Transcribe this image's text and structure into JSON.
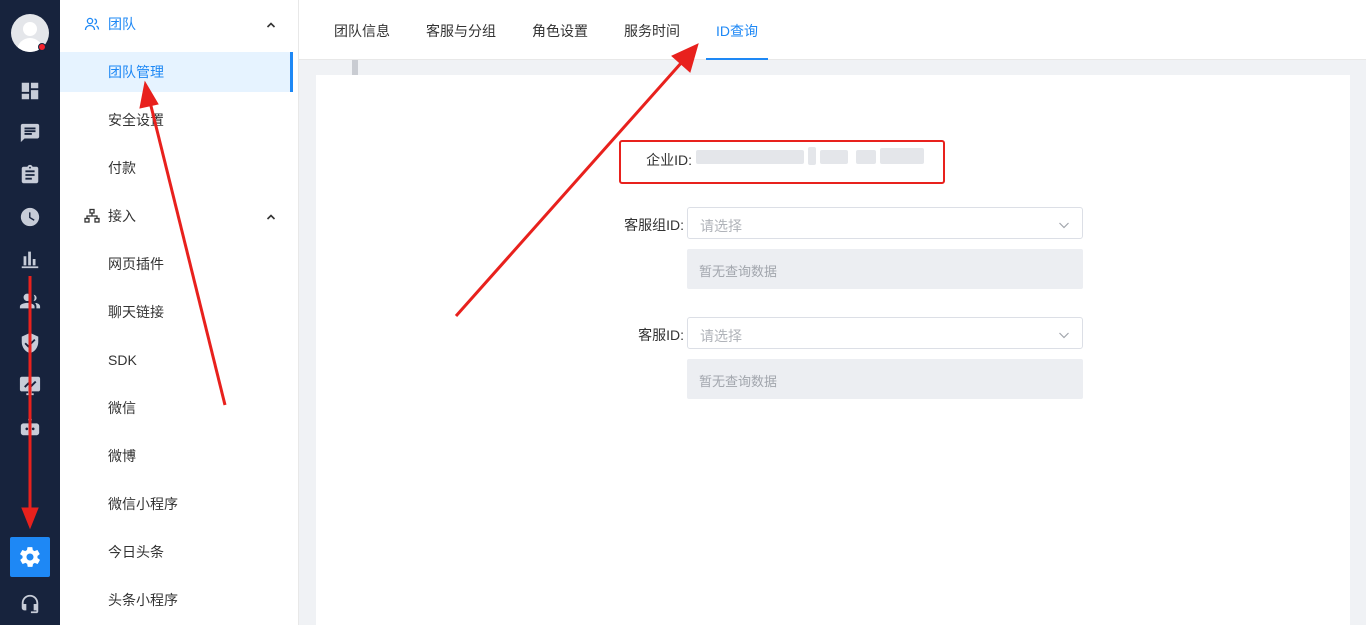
{
  "rail": {
    "icons": [
      "dashboard-icon",
      "chat-icon",
      "clipboard-icon",
      "clock-icon",
      "bar-chart-icon",
      "users-icon",
      "shield-icon",
      "monitor-chart-icon",
      "robot-icon",
      "settings-icon",
      "headset-icon"
    ],
    "active_icon": "settings-icon",
    "accent": "#1e88f5",
    "background": "#17233d"
  },
  "submenu": {
    "team_group": {
      "label": "团队",
      "items": [
        "团队管理",
        "安全设置",
        "付款"
      ],
      "active_item": "团队管理"
    },
    "access_group": {
      "label": "接入",
      "items": [
        "网页插件",
        "聊天链接",
        "SDK",
        "微信",
        "微博",
        "微信小程序",
        "今日头条",
        "头条小程序"
      ]
    }
  },
  "tabs": {
    "items": [
      "团队信息",
      "客服与分组",
      "角色设置",
      "服务时间",
      "ID查询"
    ],
    "active": "ID查询"
  },
  "form": {
    "enterprise_id_label": "企业ID:",
    "group_id_label": "客服组ID:",
    "group_select_placeholder": "请选择",
    "group_empty_text": "暂无查询数据",
    "agent_id_label": "客服ID:",
    "agent_select_placeholder": "请选择",
    "agent_empty_text": "暂无查询数据"
  },
  "annotation_color": "#e8211d"
}
